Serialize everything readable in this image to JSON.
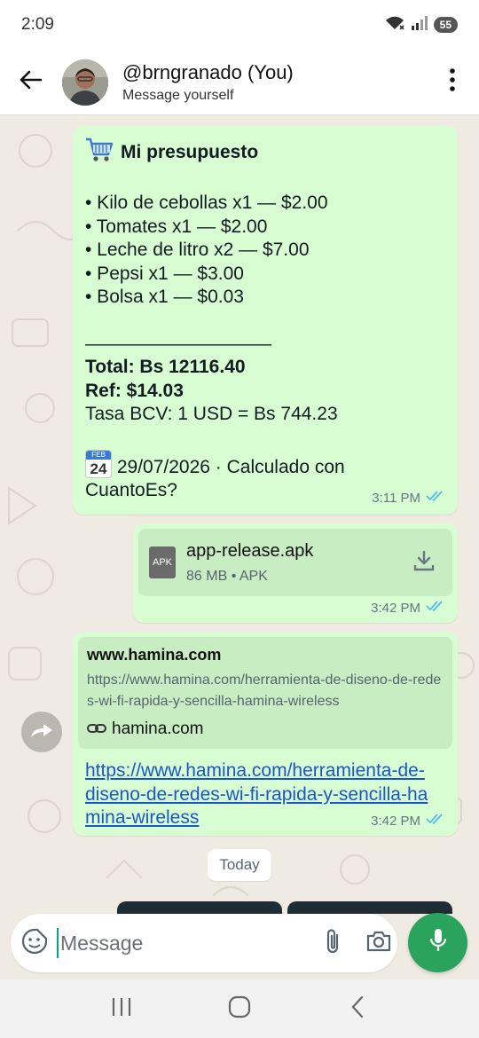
{
  "status_bar": {
    "time": "2:09",
    "battery": "55",
    "icons": [
      "wifi-icon",
      "signal-icon",
      "battery-icon"
    ]
  },
  "header": {
    "title": "@brngranado (You)",
    "subtitle": "Message yourself",
    "icons": [
      "back-arrow-icon",
      "avatar",
      "more-vert-icon"
    ]
  },
  "messages": [
    {
      "type": "text",
      "title_emoji": "shopping-cart-icon",
      "title": "Mi presupuesto",
      "items": [
        "• Kilo de cebollas  x1 — $2.00",
        "• Tomates x1 — $2.00",
        "• Leche de litro x2 — $7.00",
        "• Pepsi x1 — $3.00",
        "• Bolsa x1 — $0.03"
      ],
      "separator": "——————————",
      "total": "Total: Bs 12116.40",
      "ref": "Ref: $14.03",
      "rate": "Tasa BCV: 1 USD = Bs 744.23",
      "calendar_emoji_month": "FEB",
      "calendar_emoji_day": "24",
      "footer": "29/07/2026 · Calculado con CuantoEs?",
      "time": "3:11 PM",
      "status": "read"
    },
    {
      "type": "file",
      "icon_label": "APK",
      "file_name": "app-release.apk",
      "file_meta": "86 MB • APK",
      "time": "3:42 PM",
      "status": "read"
    },
    {
      "type": "link",
      "preview_title": "www.hamina.com",
      "preview_desc": "https://www.hamina.com/herramienta-de-diseno-de-redes-wi-fi-rapida-y-sencilla-hamina-wireless",
      "preview_domain": "hamina.com",
      "link_text": "https://www.hamina.com/herramienta-de-diseno-de-redes-wi-fi-rapida-y-sencilla-hamina-wireless",
      "time": "3:42 PM",
      "status": "read"
    }
  ],
  "date_divider": "Today",
  "composer": {
    "placeholder": "Message"
  },
  "colors": {
    "bubble": "#d9fdd3",
    "chat_bg": "#efeae2",
    "accent_green": "#2aa45d",
    "read_ticks": "#53bdeb",
    "link": "#1a56c9"
  }
}
